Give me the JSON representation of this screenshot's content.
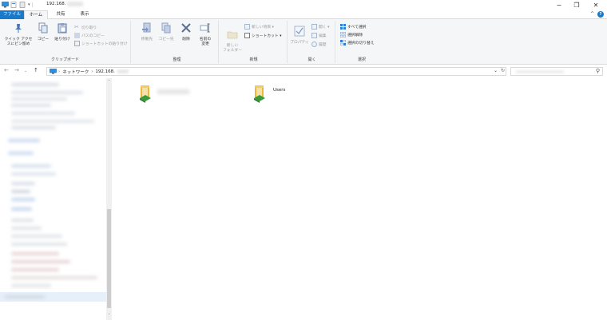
{
  "window": {
    "title": "192.168.",
    "minimize": "−",
    "maximize": "❐",
    "close": "✕"
  },
  "tabs": [
    {
      "label": "ファイル"
    },
    {
      "label": "ホーム"
    },
    {
      "label": "共有"
    },
    {
      "label": "表示"
    }
  ],
  "ribbon": {
    "clipboard": {
      "pin_label": "クイック アクセスにピン留め",
      "pin_l1": "クイック アクセ",
      "pin_l2": "スにピン留め",
      "copy": "コピー",
      "paste": "貼り付け",
      "cut": "切り取り",
      "copy_path": "パスのコピー",
      "paste_shortcut": "ショートカットの貼り付け",
      "group_label": "クリップボード"
    },
    "organize": {
      "move_to": "移動先",
      "copy_to": "コピー先",
      "delete": "削除",
      "rename_l1": "名前の",
      "rename_l2": "変更",
      "group_label": "整理"
    },
    "new": {
      "new_item": "新しい項目 ▾",
      "shortcut": "ショートカット ▾",
      "new_folder_l1": "新しい",
      "new_folder_l2": "フォルダー",
      "group_label": "新規"
    },
    "open": {
      "properties": "プロパティ",
      "open": "開く ▾",
      "edit": "編集",
      "history": "履歴",
      "group_label": "開く"
    },
    "select": {
      "select_all": "すべて選択",
      "select_none": "選択解除",
      "invert": "選択の切り替え",
      "group_label": "選択"
    }
  },
  "address": {
    "crumbs": [
      "ネットワーク",
      "192.168."
    ],
    "sep": "›"
  },
  "content": {
    "items": [
      {
        "name": ""
      },
      {
        "name": "Users"
      }
    ]
  },
  "colors": {
    "accent": "#1979ca",
    "folder": "#e8b93c",
    "share": "#3a9a3a"
  }
}
